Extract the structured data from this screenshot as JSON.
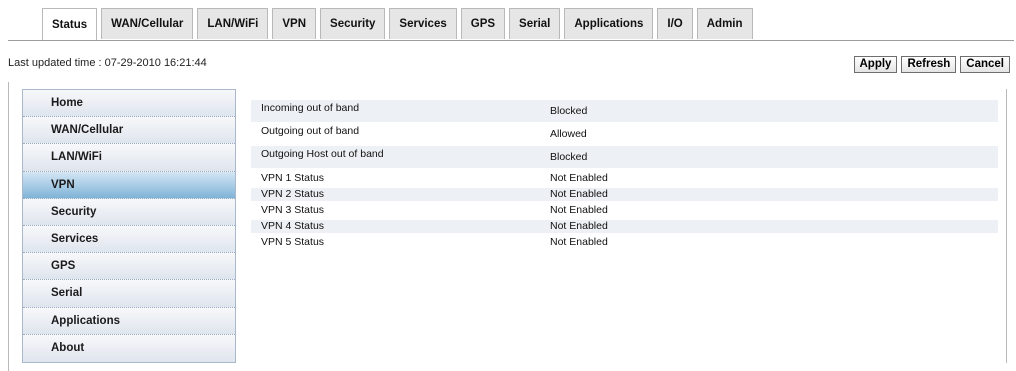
{
  "tabs": [
    "Status",
    "WAN/Cellular",
    "LAN/WiFi",
    "VPN",
    "Security",
    "Services",
    "GPS",
    "Serial",
    "Applications",
    "I/O",
    "Admin"
  ],
  "active_tab": "Status",
  "last_updated": "Last updated time : 07-29-2010 16:21:44",
  "buttons": {
    "apply": "Apply",
    "refresh": "Refresh",
    "cancel": "Cancel"
  },
  "sidebar": {
    "active": "VPN",
    "items": [
      "Home",
      "WAN/Cellular",
      "LAN/WiFi",
      "VPN",
      "Security",
      "Services",
      "GPS",
      "Serial",
      "Applications",
      "About"
    ]
  },
  "vpn_status": [
    {
      "label": "Incoming out of band",
      "value": "Blocked"
    },
    {
      "label": "Outgoing out of band",
      "value": "Allowed"
    },
    {
      "label": "Outgoing Host out of band",
      "value": "Blocked"
    },
    {
      "label": "VPN 1 Status",
      "value": "Not Enabled"
    },
    {
      "label": "VPN 2 Status",
      "value": "Not Enabled"
    },
    {
      "label": "VPN 3 Status",
      "value": "Not Enabled"
    },
    {
      "label": "VPN 4 Status",
      "value": "Not Enabled"
    },
    {
      "label": "VPN 5 Status",
      "value": "Not Enabled"
    }
  ],
  "colors": {
    "active_sidebar": "#7fb3d8",
    "shade_row": "#edf0f4",
    "tab_bg": "#e6e6e6"
  }
}
